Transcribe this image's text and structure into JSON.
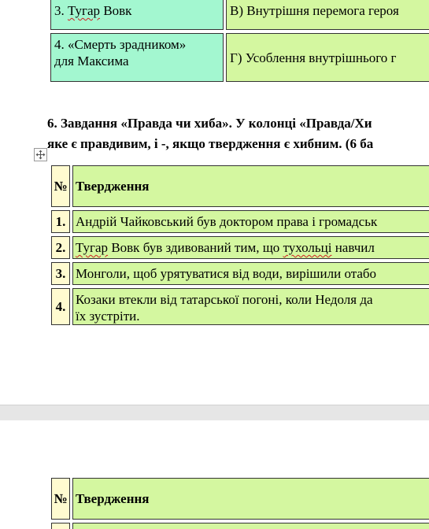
{
  "matching_table": {
    "rows": [
      {
        "left_prefix": "3. ",
        "left_squiggle": "Тугар",
        "left_suffix": " Вовк",
        "right": "В) Внутрішня перемога героя"
      },
      {
        "left_line1": "4.  «Смерть  зрадником»",
        "left_line2": "для Максима",
        "right": "Г) Усоблення внутрішнього г"
      }
    ]
  },
  "task6": {
    "line1": "6. Завдання  «Правда чи хиба».  У колонці «Правда/Хи",
    "line2": "яке є правдивим, і -, якщо твердження є хибним. (6 ба"
  },
  "statements_table": {
    "header": {
      "num": "№",
      "statement": "Твердження"
    },
    "rows": [
      {
        "num": "1.",
        "text": "Андрій Чайковський був доктором права і громадськ"
      },
      {
        "num": "2.",
        "parts": [
          "Тугар",
          " Вовк був здивований тим, що ",
          "тухольці",
          " навчил"
        ]
      },
      {
        "num": "3.",
        "text": "Монголи, щоб урятуватися від води, вирішили отабо"
      },
      {
        "num": "4.",
        "line1": "Козаки втекли від татарської погоні, коли Недоля да",
        "line2": "їх зустріти."
      }
    ]
  },
  "page2_table": {
    "header": {
      "num": "№",
      "statement": "Твердження"
    }
  }
}
